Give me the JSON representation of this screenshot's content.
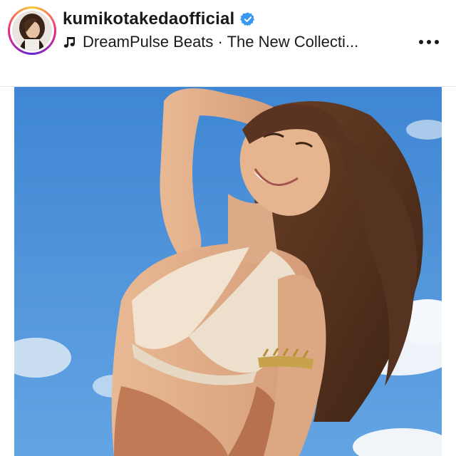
{
  "post": {
    "username": "kumikotakedaofficial",
    "verified": true,
    "audio_label": "DreamPulse Beats · The New Collecti...",
    "icons": {
      "avatar": "profile-photo",
      "verified": "verified-badge-icon",
      "music": "music-note-icon",
      "more": "more-options-icon",
      "media": "photo-woman-swimsuit-sky"
    },
    "colors": {
      "verified_blue": "#3897f0",
      "text": "#1a1a1a",
      "sky": "#4a8fd6"
    }
  }
}
